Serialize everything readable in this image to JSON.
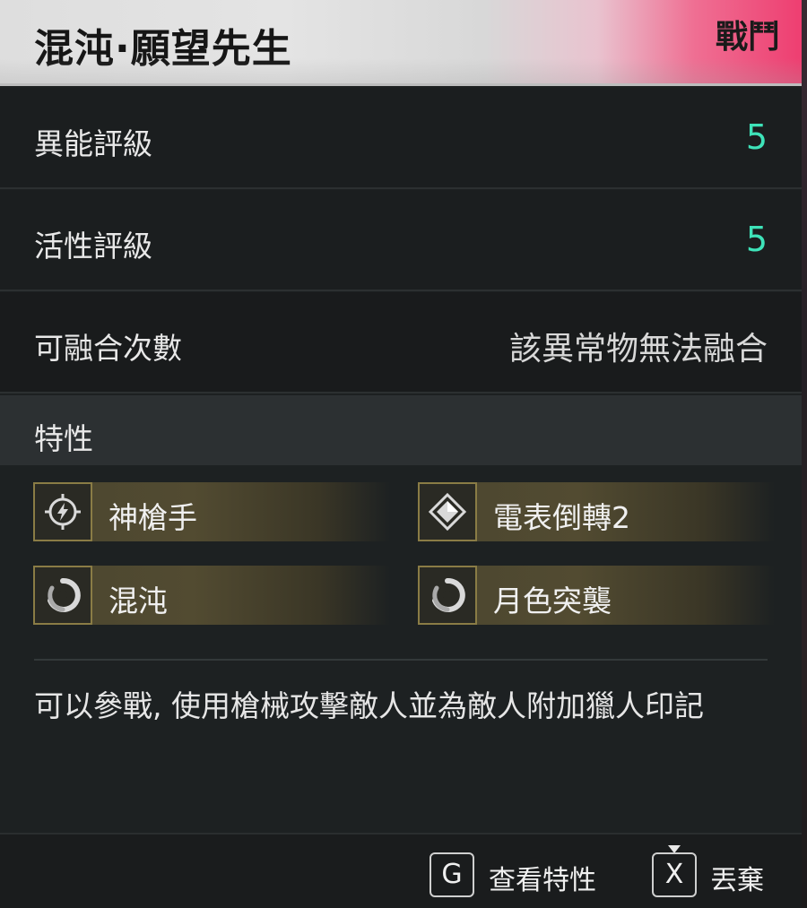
{
  "header": {
    "title": "混沌·願望先生",
    "tag": "戰鬥"
  },
  "stats": {
    "rank_label": "異能評級",
    "rank_value": "5",
    "activity_label": "活性評級",
    "activity_value": "5",
    "fusion_label": "可融合次數",
    "fusion_value": "該異常物無法融合"
  },
  "traits": {
    "heading": "特性",
    "items": [
      {
        "label": "神槍手",
        "icon": "lightning-crosshair-icon"
      },
      {
        "label": "電表倒轉2",
        "icon": "diamond-icon"
      },
      {
        "label": "混沌",
        "icon": "swirl-icon"
      },
      {
        "label": "月色突襲",
        "icon": "swirl-icon"
      }
    ]
  },
  "description": "可以參戰, 使用槍械攻擊敵人並為敵人附加獵人印記",
  "footer": {
    "view_key": "G",
    "view_label": "查看特性",
    "discard_key": "X",
    "discard_label": "丟棄"
  },
  "colors": {
    "accent_value": "#3ee3b9",
    "header_pink": "#ee3c6f",
    "trait_gold": "#8a7c45"
  }
}
